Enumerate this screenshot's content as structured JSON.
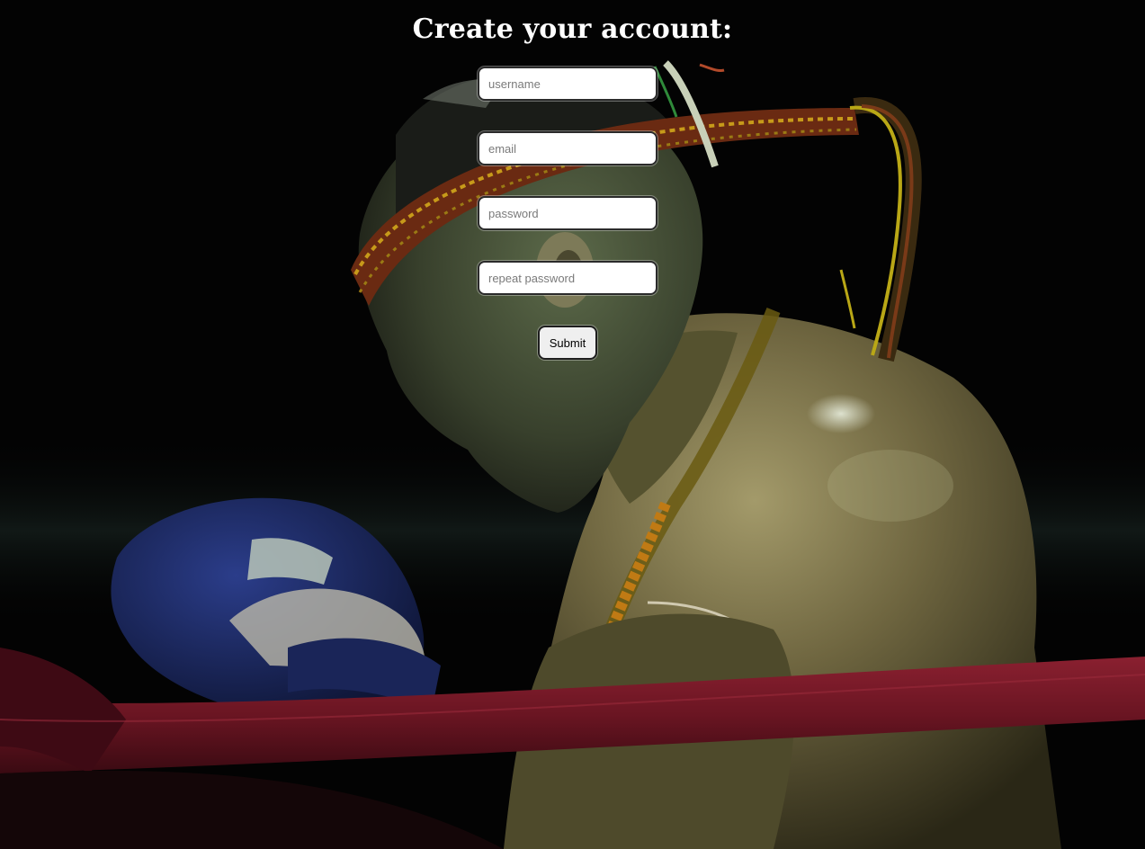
{
  "form": {
    "title": "Create your account:",
    "username_placeholder": "username",
    "email_placeholder": "email",
    "password_placeholder": "password",
    "repeat_password_placeholder": "repeat password",
    "submit_label": "Submit"
  },
  "background": {
    "subject": "muay-thai-fighter-photo",
    "colors": {
      "base": "#030303",
      "skin": "#8a7a4e",
      "glove": "#1f2c6b",
      "rope": "#6a1522",
      "headband": "#7a3a18"
    }
  }
}
